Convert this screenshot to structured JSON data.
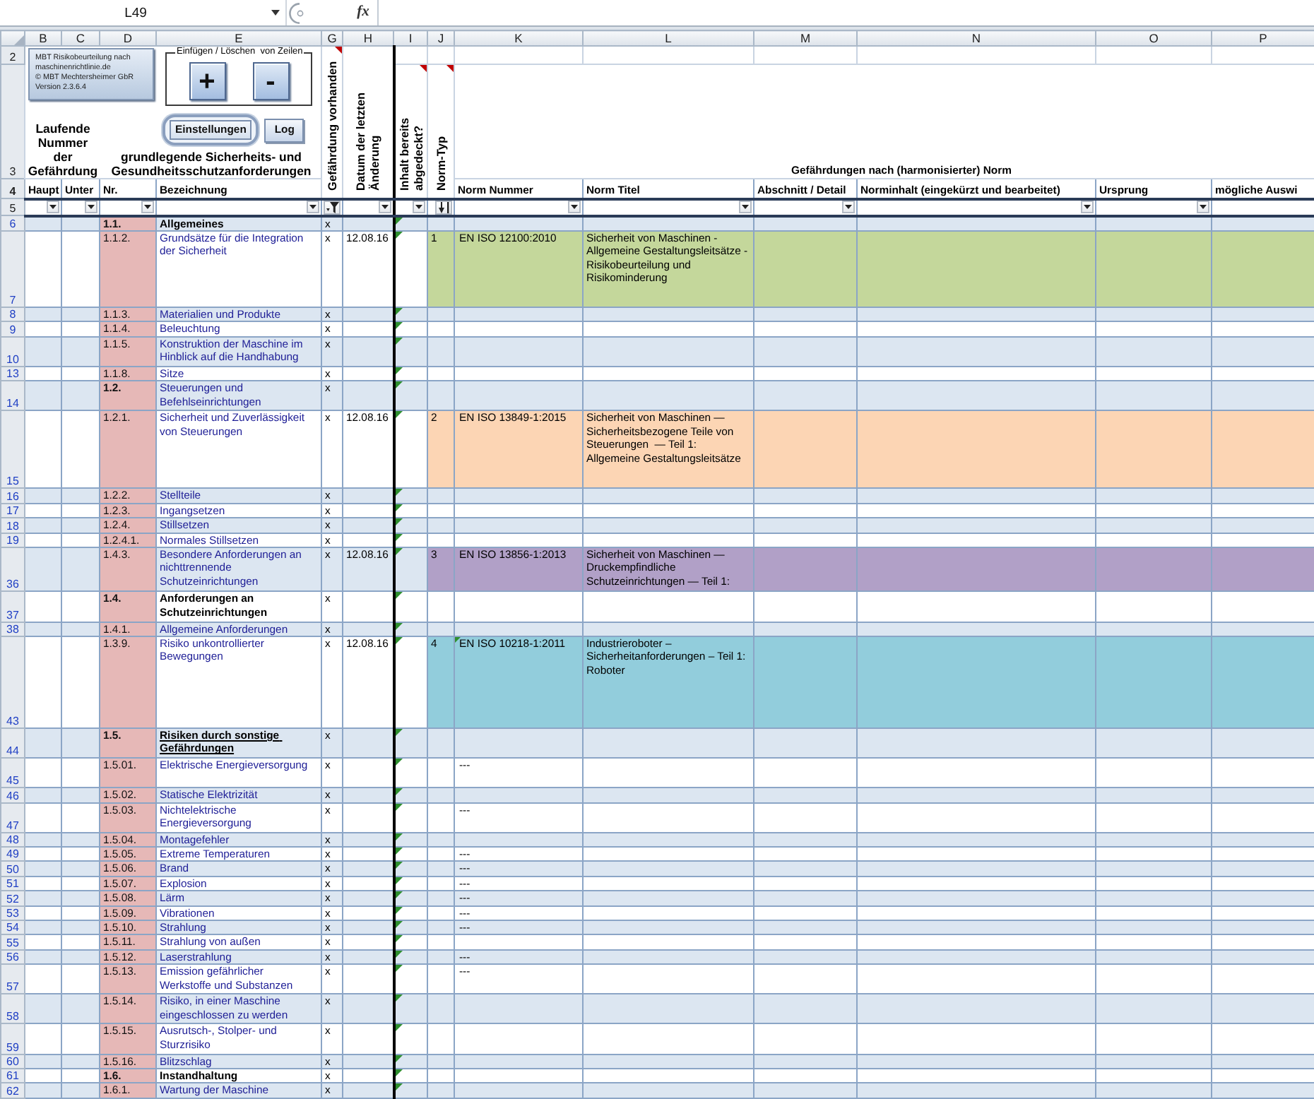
{
  "formula_bar": {
    "name_box": "L49",
    "function_label": "fx"
  },
  "column_letters": [
    "B",
    "C",
    "D",
    "E",
    "G",
    "H",
    "I",
    "J",
    "K",
    "L",
    "M",
    "N",
    "O",
    "P"
  ],
  "header_row_numbers": [
    "2",
    "3",
    "4",
    "5"
  ],
  "header": {
    "info_lines": [
      "MBT Risikobeurteilung nach",
      "maschinenrichtlinie.de",
      "© MBT Mechtersheimer GbR",
      "Version 2.3.6.4"
    ],
    "group_title": "Einfügen / Löschen  von Zeilen",
    "add_button": "+",
    "remove_button": "-",
    "settings_button": "Einstellungen",
    "log_button": "Log",
    "number_heading": "Laufende Nummer der Gefährdung",
    "requirements_heading": "grundlegende Sicherheits- und Gesundheitsschutzanforderungen",
    "vertical_headings": [
      {
        "text": "Gefährdung vorhanden",
        "comment": true
      },
      {
        "text": "Datum der letzten Änderung",
        "comment": false
      },
      {
        "text": "Inhalt bereits abgedeckt?",
        "comment": true
      },
      {
        "text": "Norm-Typ",
        "comment": true
      }
    ],
    "norm_heading": "Gefährdungen nach (harmonisierter) Norm",
    "column_headings": [
      "Haupt",
      "Unter",
      "Nr.",
      "Bezeichnung",
      "Norm Nummer",
      "Norm Titel",
      "Abschnitt / Detail",
      "Norminhalt (eingekürzt und bearbeitet)",
      "Ursprung",
      "mögliche Auswi"
    ]
  },
  "filters": [
    {
      "kind": "dropdown"
    },
    {
      "kind": "dropdown"
    },
    {
      "kind": "dropdown"
    },
    {
      "kind": "dropdown"
    },
    {
      "kind": "filtered"
    },
    {
      "kind": "dropdown"
    },
    {
      "kind": "dropdown"
    },
    {
      "kind": "sorted"
    },
    {
      "kind": "dropdown"
    },
    {
      "kind": "dropdown"
    },
    {
      "kind": "dropdown"
    },
    {
      "kind": "dropdown"
    },
    {
      "kind": "dropdown"
    }
  ],
  "rows": [
    {
      "row": "6",
      "nr": "1.1.",
      "section": true,
      "title": "Allgemeines",
      "kind": "heading",
      "hazard": "x",
      "inhalt_marker": true
    },
    {
      "row": "7",
      "nr": "1.1.2.",
      "section": false,
      "title": "Grundsätze für die Integration der Sicherheit",
      "kind": "plain",
      "hazard": "x",
      "date": "12.08.16",
      "inhalt_marker": true,
      "norm": {
        "type": "1",
        "number": "EN ISO 12100:2010",
        "title": "Sicherheit von Maschinen - Allgemeine Gestaltungsleitsätze - Risikobeurteilung und Risikominderung",
        "color": "#c4d79b",
        "marker": false
      }
    },
    {
      "row": "8",
      "nr": "1.1.3.",
      "section": false,
      "title": "Materialien und Produkte",
      "kind": "plain",
      "hazard": "x",
      "inhalt_marker": true
    },
    {
      "row": "9",
      "nr": "1.1.4.",
      "section": false,
      "title": "Beleuchtung",
      "kind": "plain",
      "hazard": "x",
      "inhalt_marker": true
    },
    {
      "row": "10",
      "nr": "1.1.5.",
      "section": false,
      "title": "Konstruktion der Maschine im Hinblick auf die Handhabung",
      "kind": "plain",
      "hazard": "x",
      "inhalt_marker": true
    },
    {
      "row": "13",
      "nr": "1.1.8.",
      "section": false,
      "title": "Sitze",
      "kind": "plain",
      "hazard": "x",
      "inhalt_marker": true
    },
    {
      "row": "14",
      "nr": "1.2.",
      "section": true,
      "title": "Steuerungen und Befehlseinrichtungen",
      "kind": "plain",
      "hazard": "x",
      "inhalt_marker": true
    },
    {
      "row": "15",
      "nr": "1.2.1.",
      "section": false,
      "title": "Sicherheit und Zuverlässigkeit von Steuerungen",
      "kind": "plain",
      "hazard": "x",
      "date": "12.08.16",
      "inhalt_marker": true,
      "norm": {
        "type": "2",
        "number": "EN ISO 13849-1:2015",
        "title": "Sicherheit von Maschinen — Sicherheitsbezogene Teile von Steuerungen  — Teil 1: Allgemeine Gestaltungsleitsätze",
        "color": "#fcd5b4",
        "marker": false
      }
    },
    {
      "row": "16",
      "nr": "1.2.2.",
      "section": false,
      "title": "Stellteile",
      "kind": "plain",
      "hazard": "x",
      "inhalt_marker": true
    },
    {
      "row": "17",
      "nr": "1.2.3.",
      "section": false,
      "title": "Ingangsetzen",
      "kind": "plain",
      "hazard": "x",
      "inhalt_marker": true
    },
    {
      "row": "18",
      "nr": "1.2.4.",
      "section": false,
      "title": "Stillsetzen",
      "kind": "plain",
      "hazard": "x",
      "inhalt_marker": true
    },
    {
      "row": "19",
      "nr": "1.2.4.1.",
      "section": false,
      "title": "Normales Stillsetzen",
      "kind": "plain",
      "hazard": "x",
      "inhalt_marker": true
    },
    {
      "row": "36",
      "nr": "1.4.3.",
      "section": false,
      "title": "Besondere Anforderungen an nichttrennende Schutzeinrichtungen",
      "kind": "plain",
      "hazard": "x",
      "date": "12.08.16",
      "inhalt_marker": true,
      "norm": {
        "type": "3",
        "number": "EN ISO 13856-1:2013",
        "title": "Sicherheit von Maschinen — Druckempfindliche Schutzeinrichtungen — Teil 1:",
        "color": "#b1a0c7",
        "marker": false
      }
    },
    {
      "row": "37",
      "nr": "1.4.",
      "section": true,
      "title": "Anforderungen an Schutzeinrichtungen",
      "kind": "heading",
      "hazard": "x",
      "inhalt_marker": true
    },
    {
      "row": "38",
      "nr": "1.4.1.",
      "section": false,
      "title": "Allgemeine Anforderungen",
      "kind": "plain",
      "hazard": "x",
      "inhalt_marker": true
    },
    {
      "row": "43",
      "nr": "1.3.9.",
      "section": false,
      "title": "Risiko unkontrollierter Bewegungen",
      "kind": "plain",
      "hazard": "x",
      "date": "12.08.16",
      "inhalt_marker": true,
      "norm": {
        "type": "4",
        "number": "EN ISO 10218-1:2011",
        "title": "Industrieroboter – Sicherheitanforderungen – Teil 1: Roboter",
        "color": "#92cddc",
        "marker": true
      }
    },
    {
      "row": "44",
      "nr": "1.5.",
      "section": true,
      "title": "Risiken durch sonstige Gefährdungen",
      "kind": "heading_underlined",
      "hazard": "x",
      "inhalt_marker": true
    },
    {
      "row": "45",
      "nr": "1.5.01.",
      "section": false,
      "title": "Elektrische Energieversorgung",
      "kind": "plain",
      "hazard": "x",
      "inhalt_marker": true,
      "norm": {
        "number": "---",
        "marker": false
      }
    },
    {
      "row": "46",
      "nr": "1.5.02.",
      "section": false,
      "title": "Statische Elektrizität",
      "kind": "plain",
      "hazard": "x",
      "inhalt_marker": true
    },
    {
      "row": "47",
      "nr": "1.5.03.",
      "section": false,
      "title": "Nichtelektrische Energieversorgung",
      "kind": "plain",
      "hazard": "x",
      "inhalt_marker": true,
      "norm": {
        "number": "---",
        "marker": false
      }
    },
    {
      "row": "48",
      "nr": "1.5.04.",
      "section": false,
      "title": "Montagefehler",
      "kind": "plain",
      "hazard": "x",
      "inhalt_marker": true
    },
    {
      "row": "49",
      "nr": "1.5.05.",
      "section": false,
      "title": "Extreme Temperaturen",
      "kind": "plain",
      "hazard": "x",
      "inhalt_marker": true,
      "norm": {
        "number": "---",
        "marker": false
      }
    },
    {
      "row": "50",
      "nr": "1.5.06.",
      "section": false,
      "title": "Brand",
      "kind": "plain",
      "hazard": "x",
      "inhalt_marker": true,
      "norm": {
        "number": "---",
        "marker": false
      }
    },
    {
      "row": "51",
      "nr": "1.5.07.",
      "section": false,
      "title": "Explosion",
      "kind": "plain",
      "hazard": "x",
      "inhalt_marker": true,
      "norm": {
        "number": "---",
        "marker": false
      }
    },
    {
      "row": "52",
      "nr": "1.5.08.",
      "section": false,
      "title": "Lärm",
      "kind": "plain",
      "hazard": "x",
      "inhalt_marker": true,
      "norm": {
        "number": "---",
        "marker": false
      }
    },
    {
      "row": "53",
      "nr": "1.5.09.",
      "section": false,
      "title": "Vibrationen",
      "kind": "plain",
      "hazard": "x",
      "inhalt_marker": true,
      "norm": {
        "number": "---",
        "marker": false
      }
    },
    {
      "row": "54",
      "nr": "1.5.10.",
      "section": false,
      "title": "Strahlung",
      "kind": "plain",
      "hazard": "x",
      "inhalt_marker": true,
      "norm": {
        "number": "---",
        "marker": false
      }
    },
    {
      "row": "55",
      "nr": "1.5.11.",
      "section": false,
      "title": "Strahlung von außen",
      "kind": "plain",
      "hazard": "x",
      "inhalt_marker": true
    },
    {
      "row": "56",
      "nr": "1.5.12.",
      "section": false,
      "title": "Laserstrahlung",
      "kind": "plain",
      "hazard": "x",
      "inhalt_marker": true,
      "norm": {
        "number": "---",
        "marker": false
      }
    },
    {
      "row": "57",
      "nr": "1.5.13.",
      "section": false,
      "title": "Emission gefährlicher Werkstoffe und Substanzen",
      "kind": "plain",
      "hazard": "x",
      "inhalt_marker": true,
      "norm": {
        "number": "---",
        "marker": false
      }
    },
    {
      "row": "58",
      "nr": "1.5.14.",
      "section": false,
      "title": "Risiko, in einer Maschine eingeschlossen zu werden",
      "kind": "plain",
      "hazard": "x",
      "inhalt_marker": true
    },
    {
      "row": "59",
      "nr": "1.5.15.",
      "section": false,
      "title": "Ausrutsch-, Stolper- und Sturzrisiko",
      "kind": "plain",
      "hazard": "x",
      "inhalt_marker": true
    },
    {
      "row": "60",
      "nr": "1.5.16.",
      "section": false,
      "title": "Blitzschlag",
      "kind": "plain",
      "hazard": "x",
      "inhalt_marker": true
    },
    {
      "row": "61",
      "nr": "1.6.",
      "section": true,
      "title": "Instandhaltung",
      "kind": "heading",
      "hazard": "x",
      "inhalt_marker": true
    },
    {
      "row": "62",
      "nr": "1.6.1.",
      "section": false,
      "title": "Wartung der Maschine",
      "kind": "plain",
      "hazard": "x",
      "inhalt_marker": true
    }
  ]
}
